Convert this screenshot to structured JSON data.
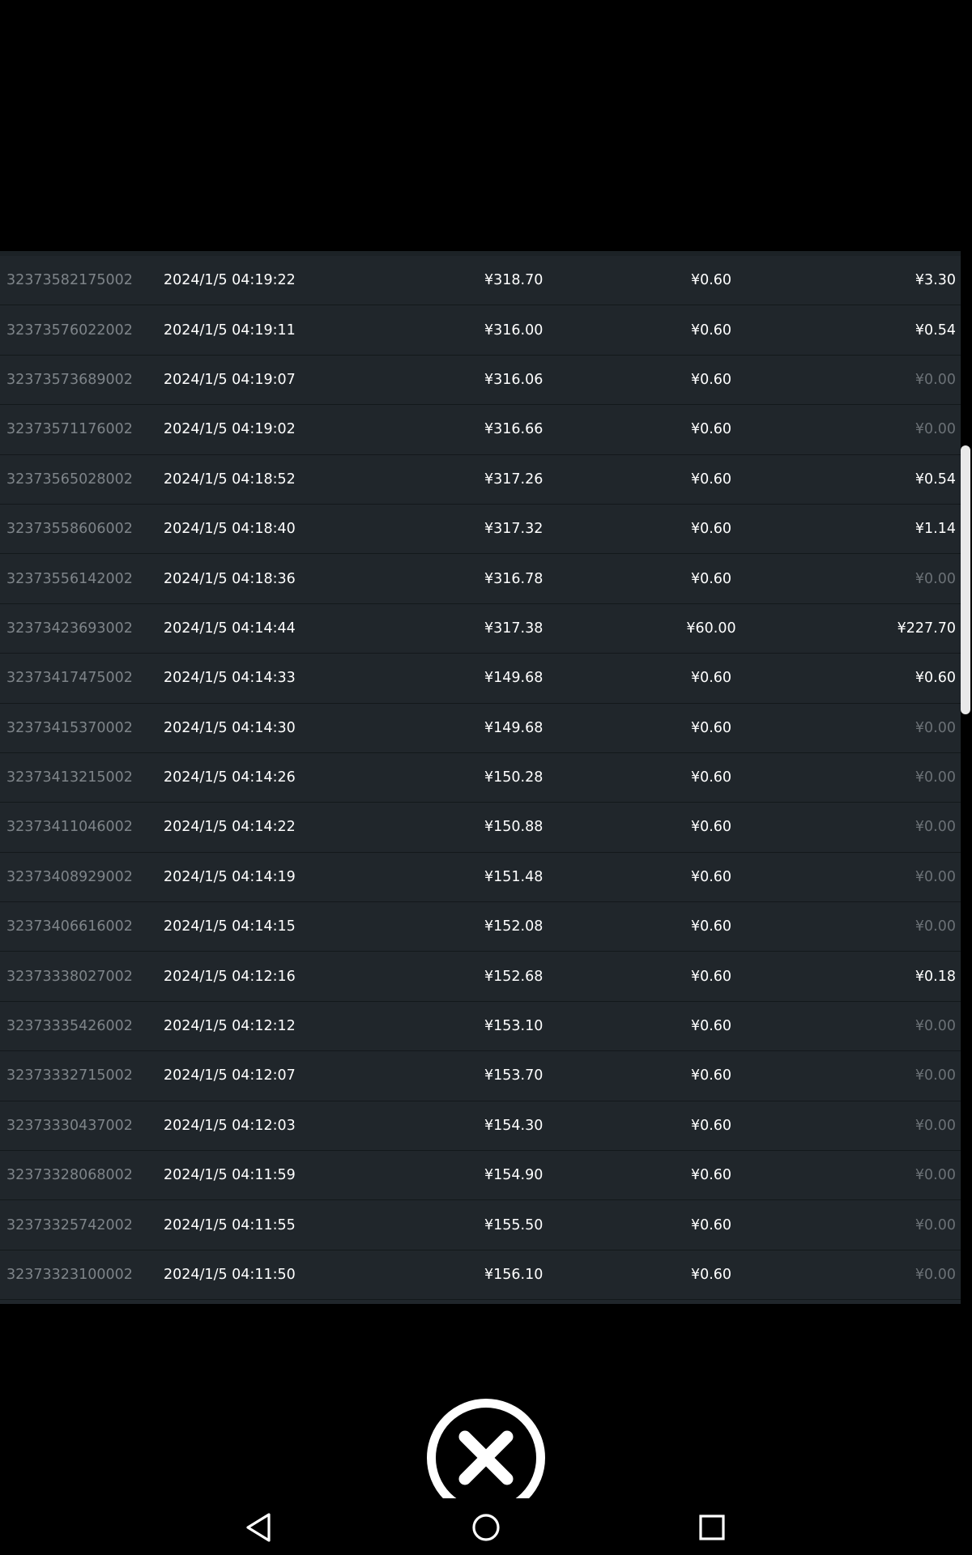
{
  "transactions": [
    {
      "id": "32373582175002",
      "time": "2024/1/5 04:19:22",
      "amount": "¥318.70",
      "fee": "¥0.60",
      "return": "¥3.30",
      "zero": false
    },
    {
      "id": "32373576022002",
      "time": "2024/1/5 04:19:11",
      "amount": "¥316.00",
      "fee": "¥0.60",
      "return": "¥0.54",
      "zero": false
    },
    {
      "id": "32373573689002",
      "time": "2024/1/5 04:19:07",
      "amount": "¥316.06",
      "fee": "¥0.60",
      "return": "¥0.00",
      "zero": true
    },
    {
      "id": "32373571176002",
      "time": "2024/1/5 04:19:02",
      "amount": "¥316.66",
      "fee": "¥0.60",
      "return": "¥0.00",
      "zero": true
    },
    {
      "id": "32373565028002",
      "time": "2024/1/5 04:18:52",
      "amount": "¥317.26",
      "fee": "¥0.60",
      "return": "¥0.54",
      "zero": false
    },
    {
      "id": "32373558606002",
      "time": "2024/1/5 04:18:40",
      "amount": "¥317.32",
      "fee": "¥0.60",
      "return": "¥1.14",
      "zero": false
    },
    {
      "id": "32373556142002",
      "time": "2024/1/5 04:18:36",
      "amount": "¥316.78",
      "fee": "¥0.60",
      "return": "¥0.00",
      "zero": true
    },
    {
      "id": "32373423693002",
      "time": "2024/1/5 04:14:44",
      "amount": "¥317.38",
      "fee": "¥60.00",
      "return": "¥227.70",
      "zero": false
    },
    {
      "id": "32373417475002",
      "time": "2024/1/5 04:14:33",
      "amount": "¥149.68",
      "fee": "¥0.60",
      "return": "¥0.60",
      "zero": false
    },
    {
      "id": "32373415370002",
      "time": "2024/1/5 04:14:30",
      "amount": "¥149.68",
      "fee": "¥0.60",
      "return": "¥0.00",
      "zero": true
    },
    {
      "id": "32373413215002",
      "time": "2024/1/5 04:14:26",
      "amount": "¥150.28",
      "fee": "¥0.60",
      "return": "¥0.00",
      "zero": true
    },
    {
      "id": "32373411046002",
      "time": "2024/1/5 04:14:22",
      "amount": "¥150.88",
      "fee": "¥0.60",
      "return": "¥0.00",
      "zero": true
    },
    {
      "id": "32373408929002",
      "time": "2024/1/5 04:14:19",
      "amount": "¥151.48",
      "fee": "¥0.60",
      "return": "¥0.00",
      "zero": true
    },
    {
      "id": "32373406616002",
      "time": "2024/1/5 04:14:15",
      "amount": "¥152.08",
      "fee": "¥0.60",
      "return": "¥0.00",
      "zero": true
    },
    {
      "id": "32373338027002",
      "time": "2024/1/5 04:12:16",
      "amount": "¥152.68",
      "fee": "¥0.60",
      "return": "¥0.18",
      "zero": false
    },
    {
      "id": "32373335426002",
      "time": "2024/1/5 04:12:12",
      "amount": "¥153.10",
      "fee": "¥0.60",
      "return": "¥0.00",
      "zero": true
    },
    {
      "id": "32373332715002",
      "time": "2024/1/5 04:12:07",
      "amount": "¥153.70",
      "fee": "¥0.60",
      "return": "¥0.00",
      "zero": true
    },
    {
      "id": "32373330437002",
      "time": "2024/1/5 04:12:03",
      "amount": "¥154.30",
      "fee": "¥0.60",
      "return": "¥0.00",
      "zero": true
    },
    {
      "id": "32373328068002",
      "time": "2024/1/5 04:11:59",
      "amount": "¥154.90",
      "fee": "¥0.60",
      "return": "¥0.00",
      "zero": true
    },
    {
      "id": "32373325742002",
      "time": "2024/1/5 04:11:55",
      "amount": "¥155.50",
      "fee": "¥0.60",
      "return": "¥0.00",
      "zero": true
    },
    {
      "id": "32373323100002",
      "time": "2024/1/5 04:11:50",
      "amount": "¥156.10",
      "fee": "¥0.60",
      "return": "¥0.00",
      "zero": true
    }
  ],
  "colors": {
    "background": "#000000",
    "table_bg": "#20262b",
    "id_text": "#7e8489",
    "value_text": "#ffffff",
    "zero_text": "#6b7176"
  },
  "icons": {
    "close": "close-icon",
    "back": "back-triangle-icon",
    "home": "home-circle-icon",
    "recents": "recents-square-icon"
  }
}
